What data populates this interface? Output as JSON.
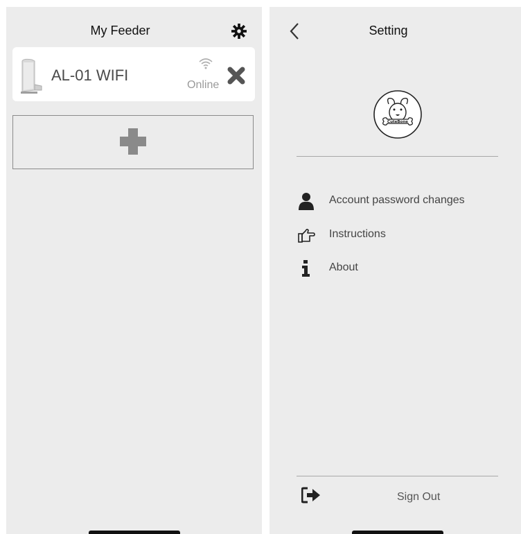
{
  "left_screen": {
    "title": "My Feeder",
    "device": {
      "name": "AL-01 WIFI",
      "status": "Online"
    },
    "icons": {
      "settings": "gear-icon",
      "wifi": "wifi-icon",
      "remove": "close-icon",
      "add": "plus-icon"
    }
  },
  "right_screen": {
    "title": "Setting",
    "logo_text": "CuteBone",
    "menu": [
      {
        "label": "Account password changes",
        "icon": "user-icon"
      },
      {
        "label": "Instructions",
        "icon": "thumb-pointing-icon"
      },
      {
        "label": "About",
        "icon": "info-icon"
      }
    ],
    "sign_out_label": "Sign Out",
    "icons": {
      "back": "chevron-left-icon",
      "sign_out": "sign-out-icon"
    }
  },
  "colors": {
    "screen_bg": "#ececec",
    "card_bg": "#ffffff",
    "icon_gray": "#8a8a8a",
    "icon_dark": "#222222"
  }
}
